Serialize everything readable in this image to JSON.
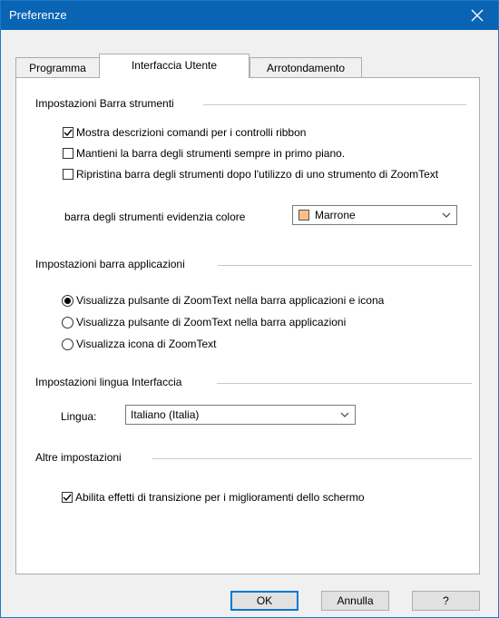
{
  "window": {
    "title": "Preferenze",
    "title_bar_color": "#0a64b4"
  },
  "tabs": [
    {
      "label": "Programma",
      "active": false
    },
    {
      "label": "Interfaccia Utente",
      "active": true
    },
    {
      "label": "Arrotondamento",
      "active": false
    }
  ],
  "toolbar_group": {
    "label": "Impostazioni Barra strumenti",
    "checkboxes": [
      {
        "label": "Mostra descrizioni comandi per i controlli ribbon",
        "checked": true
      },
      {
        "label": "Mantieni la barra degli strumenti sempre in primo piano.",
        "checked": false
      },
      {
        "label": "Ripristina barra degli strumenti dopo l'utilizzo di uno strumento di ZoomText",
        "checked": false
      }
    ],
    "color_label": "barra degli strumenti evidenzia colore",
    "color_value": "Marrone",
    "color_swatch": "#f7c08a"
  },
  "appbar_group": {
    "label": "Impostazioni barra applicazioni",
    "radios": [
      {
        "label": "Visualizza pulsante di ZoomText nella barra applicazioni e icona",
        "selected": true
      },
      {
        "label": "Visualizza pulsante di ZoomText nella barra applicazioni",
        "selected": false
      },
      {
        "label": "Visualizza icona di ZoomText",
        "selected": false
      }
    ]
  },
  "language_group": {
    "label": "Impostazioni lingua Interfaccia",
    "field_label": "Lingua:",
    "value": "Italiano (Italia)"
  },
  "other_group": {
    "label": "Altre impostazioni",
    "checkboxes": [
      {
        "label": "Abilita effetti di transizione per i miglioramenti dello schermo",
        "checked": true
      }
    ]
  },
  "buttons": {
    "ok": "OK",
    "cancel": "Annulla",
    "help": "?"
  }
}
